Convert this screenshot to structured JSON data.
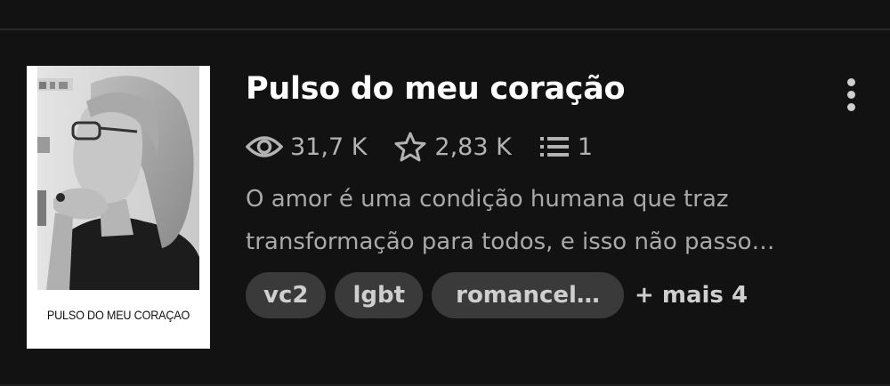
{
  "story": {
    "title": "Pulso do meu coração",
    "cover_text": "PULSO DO MEU CORAÇAO",
    "reads": "31,7 K",
    "votes": "2,83 K",
    "parts": "1",
    "description_lines": [
      "O amor é uma condição humana que traz",
      "transformação para todos, e isso não passo…"
    ],
    "tags": [
      "vc2",
      "lgbt",
      "romancel…"
    ],
    "more_tags": "+ mais 4"
  },
  "icons": {
    "reads": "eye-icon",
    "votes": "star-icon",
    "parts": "list-icon",
    "menu": "more-vertical-icon"
  },
  "colors": {
    "background": "#121212",
    "title": "#ffffff",
    "secondary_text": "#b3b3b3",
    "tag_background": "#3a3a3a"
  }
}
